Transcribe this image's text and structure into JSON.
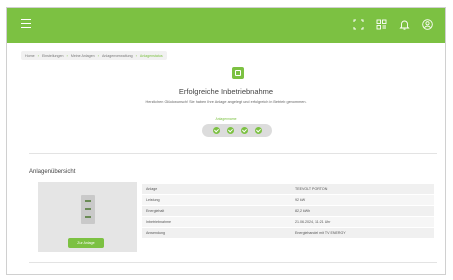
{
  "colors": {
    "accent": "#7cc142",
    "topbar": "#7cc142"
  },
  "topbar": {
    "icons": [
      "menu-icon",
      "scan-icon",
      "grid-icon",
      "bell-icon",
      "user-icon"
    ]
  },
  "breadcrumb": {
    "items": [
      "Home",
      "Einstellungen",
      "Meine Anlagen",
      "Anlagenverwaltung",
      "Anlagenstatus"
    ]
  },
  "hero": {
    "title": "Erfolgreiche Inbetriebnahme",
    "subtitle": "Herzlichen Glückwunsch! Sie haben Ihre Anlage angelegt und erfolgreich in Betrieb genommen.",
    "status_label": "Anlagenname"
  },
  "overview": {
    "title": "Anlagenübersicht",
    "device_button": "Zur Anlage",
    "rows": [
      {
        "key": "Anlage",
        "value": "TEEVOLT PORTON"
      },
      {
        "key": "Leistung",
        "value": "92 kW"
      },
      {
        "key": "Energiehalt",
        "value": "82,2 kWh"
      },
      {
        "key": "Inbetriebnahme",
        "value": "21.06.2024, 11:21 Uhr"
      },
      {
        "key": "Anwendung",
        "value": "Energiehandel mit TV ENERGY"
      }
    ]
  }
}
